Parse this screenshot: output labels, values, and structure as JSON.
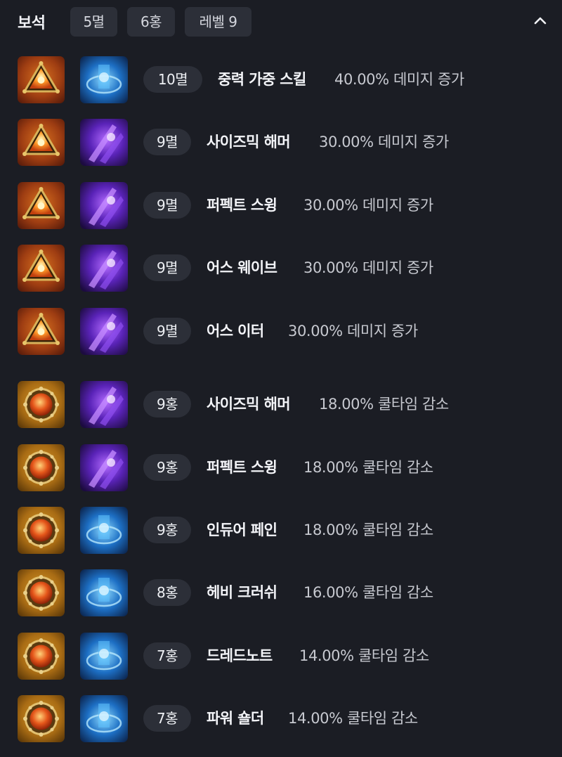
{
  "header": {
    "title": "보석",
    "chips": [
      "5멸",
      "6홍",
      "레벨 9"
    ]
  },
  "colors": {
    "background": "#1b1d24",
    "chip": "#2c2f38",
    "text_primary": "#f3f4f8",
    "text_secondary": "#c7c9d0",
    "gem_annihilation": "#b04a18",
    "gem_crimson": "#c0841f"
  },
  "gems": [
    {
      "type": "annihilation",
      "gem_icon": "annihilation-gem-icon",
      "skill_icon": "gravity-skill-icon",
      "skill_theme": "blue",
      "level": "10멸",
      "skill": "중력 가중 스킬",
      "effect": "40.00% 데미지 증가"
    },
    {
      "type": "annihilation",
      "gem_icon": "annihilation-gem-icon",
      "skill_icon": "seismic-hammer-icon",
      "skill_theme": "purple",
      "level": "9멸",
      "skill": "사이즈믹 해머",
      "effect": "30.00% 데미지 증가"
    },
    {
      "type": "annihilation",
      "gem_icon": "annihilation-gem-icon",
      "skill_icon": "perfect-swing-icon",
      "skill_theme": "purple",
      "level": "9멸",
      "skill": "퍼펙트 스윙",
      "effect": "30.00% 데미지 증가"
    },
    {
      "type": "annihilation",
      "gem_icon": "annihilation-gem-icon",
      "skill_icon": "earth-wave-icon",
      "skill_theme": "purple",
      "level": "9멸",
      "skill": "어스 웨이브",
      "effect": "30.00% 데미지 증가"
    },
    {
      "type": "annihilation",
      "gem_icon": "annihilation-gem-icon",
      "skill_icon": "earth-eater-icon",
      "skill_theme": "purple",
      "level": "9멸",
      "skill": "어스 이터",
      "effect": "30.00% 데미지 증가"
    },
    {
      "type": "crimson",
      "gem_icon": "crimson-gem-icon",
      "skill_icon": "seismic-hammer-icon",
      "skill_theme": "purple",
      "level": "9홍",
      "skill": "사이즈믹 해머",
      "effect": "18.00% 쿨타임 감소"
    },
    {
      "type": "crimson",
      "gem_icon": "crimson-gem-icon",
      "skill_icon": "perfect-swing-icon",
      "skill_theme": "purple",
      "level": "9홍",
      "skill": "퍼펙트 스윙",
      "effect": "18.00% 쿨타임 감소"
    },
    {
      "type": "crimson",
      "gem_icon": "crimson-gem-icon",
      "skill_icon": "endure-pain-icon",
      "skill_theme": "blue",
      "level": "9홍",
      "skill": "인듀어 페인",
      "effect": "18.00% 쿨타임 감소"
    },
    {
      "type": "crimson",
      "gem_icon": "crimson-gem-icon",
      "skill_icon": "heavy-crush-icon",
      "skill_theme": "blue",
      "level": "8홍",
      "skill": "헤비 크러쉬",
      "effect": "16.00% 쿨타임 감소"
    },
    {
      "type": "crimson",
      "gem_icon": "crimson-gem-icon",
      "skill_icon": "dreadnought-icon",
      "skill_theme": "blue",
      "level": "7홍",
      "skill": "드레드노트",
      "effect": "14.00% 쿨타임 감소"
    },
    {
      "type": "crimson",
      "gem_icon": "crimson-gem-icon",
      "skill_icon": "power-shoulder-icon",
      "skill_theme": "blue",
      "level": "7홍",
      "skill": "파워 숄더",
      "effect": "14.00% 쿨타임 감소"
    }
  ]
}
